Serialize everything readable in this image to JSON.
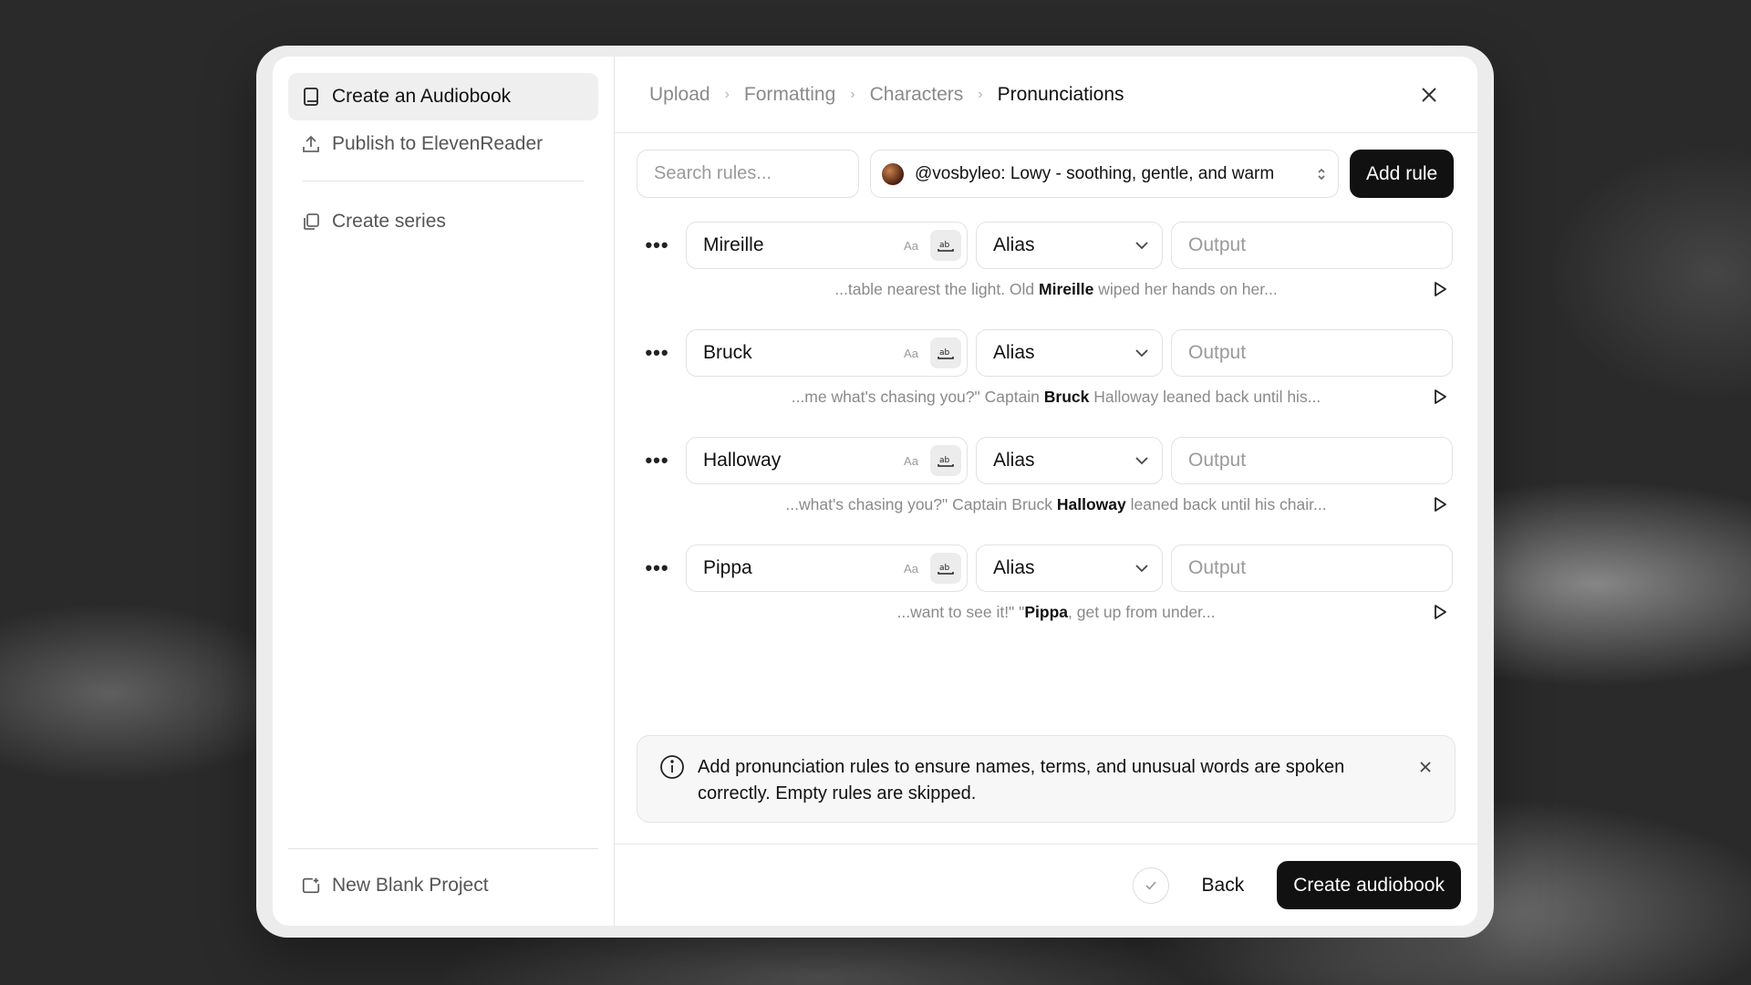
{
  "sidebar": {
    "items": [
      {
        "label": "Create an Audiobook",
        "icon": "book-icon"
      },
      {
        "label": "Publish to ElevenReader",
        "icon": "upload-icon"
      },
      {
        "label": "Create series",
        "icon": "copy-icon"
      }
    ],
    "bottom": {
      "label": "New Blank Project",
      "icon": "new-project-icon"
    }
  },
  "breadcrumb": [
    "Upload",
    "Formatting",
    "Characters",
    "Pronunciations"
  ],
  "toolbar": {
    "search_placeholder": "Search rules...",
    "voice_label": "@vosbyleo: Lowy - soothing, gentle, and warm",
    "add_rule_label": "Add rule"
  },
  "rules": [
    {
      "term": "Mireille",
      "type": "Alias",
      "output_placeholder": "Output",
      "aa": "Aa",
      "context_before": "...table nearest the light. Old ",
      "context_term": "Mireille",
      "context_after": " wiped her hands on her..."
    },
    {
      "term": "Bruck",
      "type": "Alias",
      "output_placeholder": "Output",
      "aa": "Aa",
      "context_before": "...me what's chasing you?\" Captain ",
      "context_term": "Bruck",
      "context_after": " Halloway leaned back until his..."
    },
    {
      "term": "Halloway",
      "type": "Alias",
      "output_placeholder": "Output",
      "aa": "Aa",
      "context_before": "...what's chasing you?\" Captain Bruck ",
      "context_term": "Halloway",
      "context_after": " leaned back until his chair..."
    },
    {
      "term": "Pippa",
      "type": "Alias",
      "output_placeholder": "Output",
      "aa": "Aa",
      "context_before": "...want to see it!\" \"",
      "context_term": "Pippa",
      "context_after": ", get up from under..."
    }
  ],
  "info": {
    "text": "Add pronunciation rules to ensure names, terms, and unusual words are spoken correctly. Empty rules are skipped."
  },
  "footer": {
    "back_label": "Back",
    "create_label": "Create audiobook"
  }
}
